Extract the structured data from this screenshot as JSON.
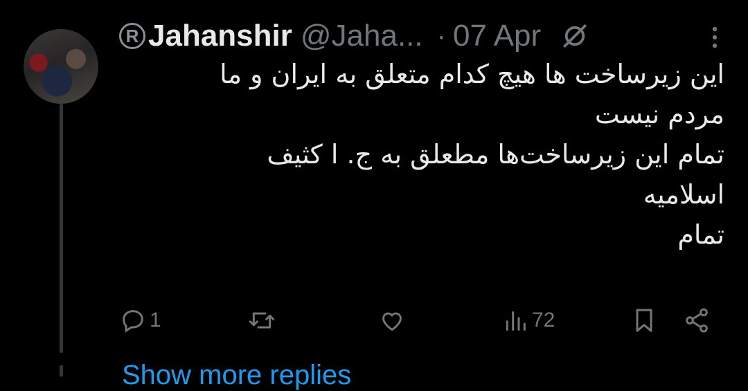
{
  "tweet": {
    "display_name": "Jahanshir",
    "badge": "R",
    "handle": "@Jaha...",
    "separator": "·",
    "date": "07 Apr",
    "lines": [
      "این زیرساخت ها هیچ کدام متعلق به ایران و ما",
      "مردم نیست",
      "تمام این زیرساخت‌ها مطعلق به ج. ا کثیف",
      "اسلامیه",
      "تمام"
    ],
    "actions": {
      "reply_count": "1",
      "retweet_count": "",
      "like_count": "",
      "views_count": "72"
    }
  },
  "show_more_label": "Show more replies",
  "colors": {
    "background": "#000000",
    "text": "#e7e9ea",
    "muted": "#71767b",
    "link": "#1d9bf0"
  },
  "icons": [
    "registered-icon",
    "grok-icon",
    "more-options-icon",
    "reply-icon",
    "retweet-icon",
    "like-icon",
    "views-icon",
    "bookmark-icon",
    "share-icon"
  ]
}
